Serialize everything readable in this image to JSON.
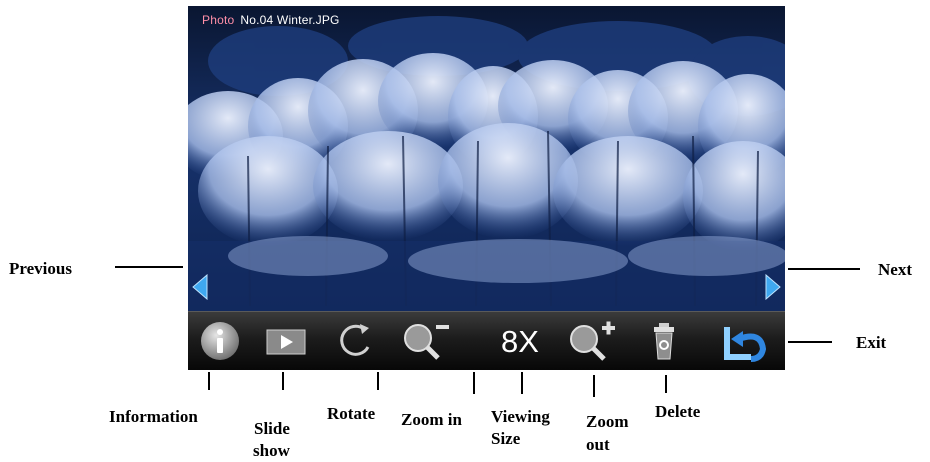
{
  "photo": {
    "caption_label": "Photo",
    "caption_file": "No.04 Winter.JPG"
  },
  "toolbar": {
    "viewing_size_value": "8X"
  },
  "callouts": {
    "previous": "Previous",
    "next": "Next",
    "exit": "Exit",
    "information": "Information",
    "slide_show_1": "Slide",
    "slide_show_2": "show",
    "rotate": "Rotate",
    "zoom_in": "Zoom in",
    "viewing_size_1": "Viewing",
    "viewing_size_2": "Size",
    "zoom_out_1": "Zoom",
    "zoom_out_2": "out",
    "delete": "Delete"
  },
  "icons": {
    "information": "info-icon",
    "slide_show": "play-icon",
    "rotate": "rotate-icon",
    "zoom_in": "zoom-minus-icon",
    "zoom_out": "zoom-plus-icon",
    "delete": "trash-icon",
    "exit": "return-arrow-icon",
    "previous": "left-triangle-icon",
    "next": "right-triangle-icon"
  },
  "colors": {
    "sky": "#0b1c3f",
    "frost": "#c9d8f2",
    "toolbar": "#1c1c1c",
    "caption_keyword": "#ff8fa8",
    "arrow": "#3fa8f0"
  }
}
